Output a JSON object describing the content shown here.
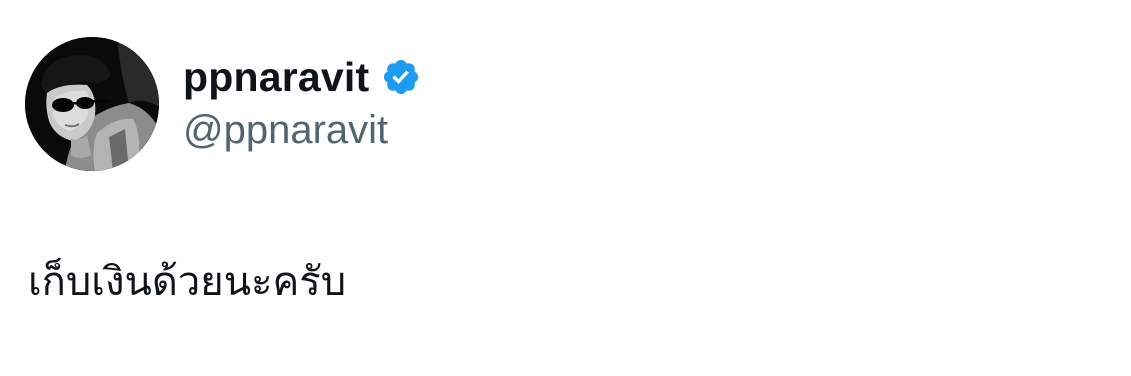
{
  "author": {
    "display_name": "ppnaravit",
    "handle": "@ppnaravit",
    "verified": true,
    "avatar_icon": "avatar-photo",
    "verified_icon": "verified-badge-icon"
  },
  "tweet": {
    "text": "เก็บเงินด้วยนะครับ"
  },
  "colors": {
    "text_primary": "#0f1419",
    "text_secondary": "#536471",
    "verified_blue": "#1d9bf0",
    "background": "#ffffff"
  }
}
